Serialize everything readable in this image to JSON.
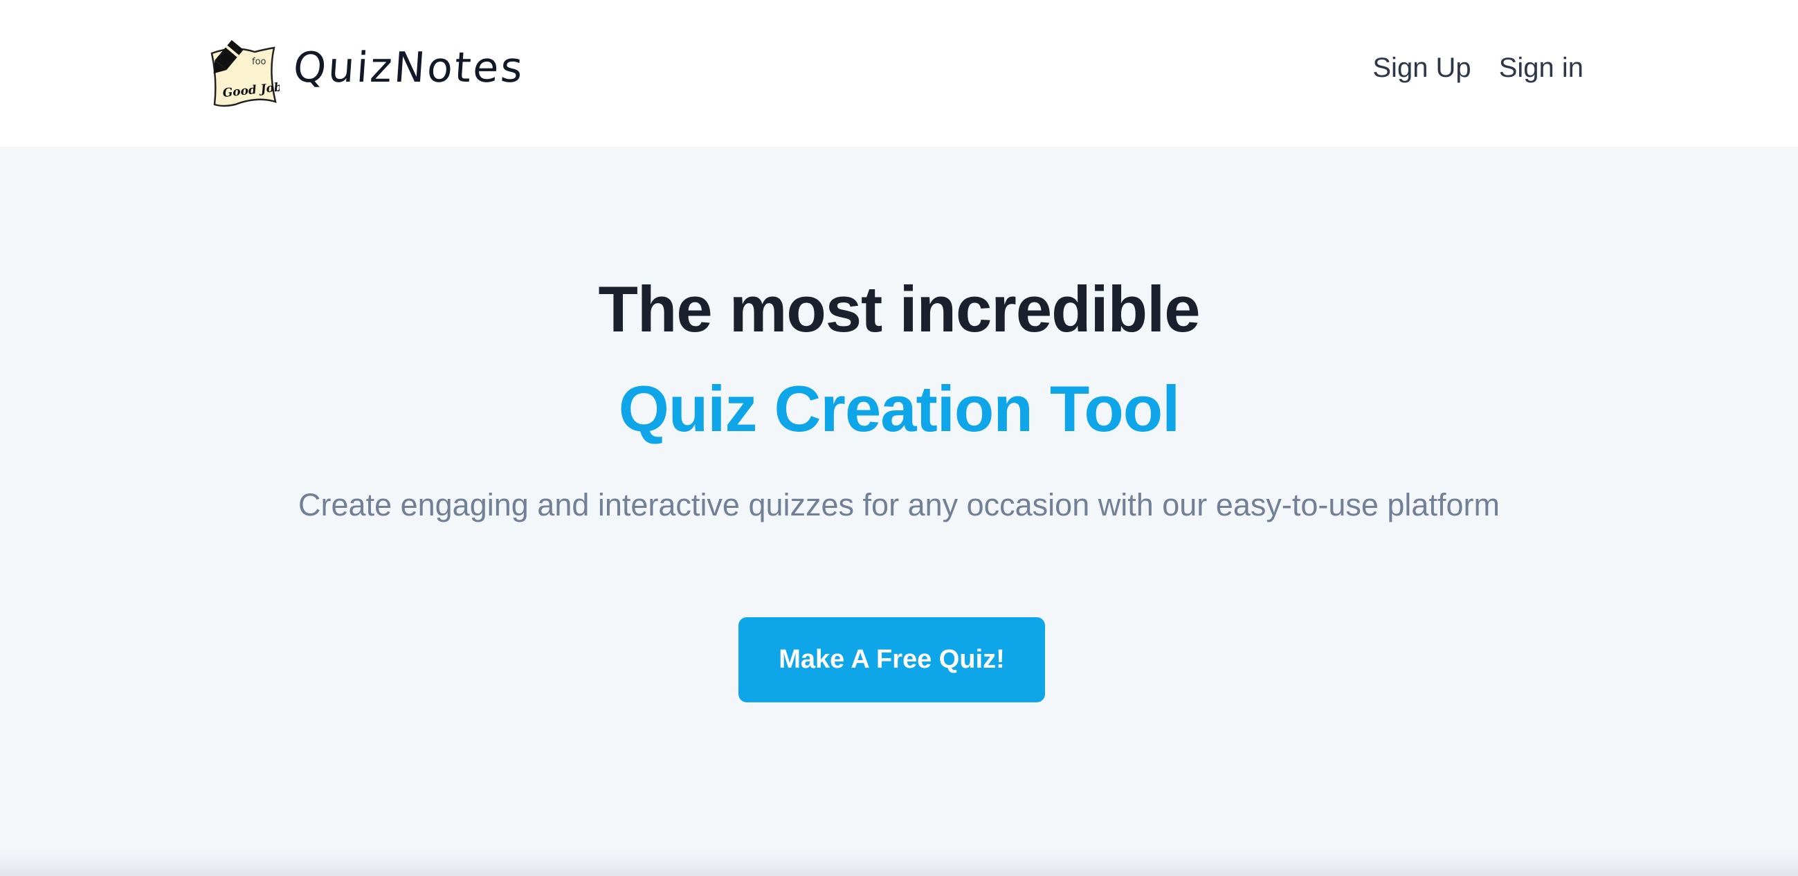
{
  "header": {
    "brand_name": "QuizNotes",
    "logo_text": "Good Job!",
    "logo_small_text": "foo",
    "nav": {
      "sign_up": "Sign Up",
      "sign_in": "Sign in"
    }
  },
  "hero": {
    "title": "The most incredible",
    "highlight": "Quiz Creation Tool",
    "subtitle": "Create engaging and interactive quizzes for any occasion with our easy-to-use platform",
    "cta_label": "Make A Free Quiz!"
  },
  "colors": {
    "accent": "#0ea5e9",
    "heading": "#1a202c",
    "muted": "#718096",
    "background": "#f4f7fa",
    "header_bg": "#ffffff"
  }
}
